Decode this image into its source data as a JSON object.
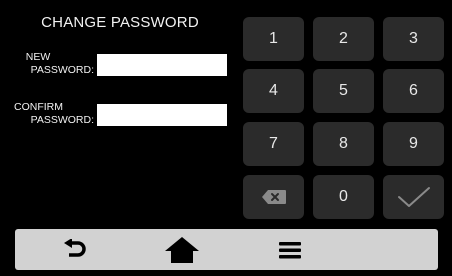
{
  "header": {
    "title": "CHANGE PASSWORD"
  },
  "form": {
    "new_password": {
      "label_line1": "NEW",
      "label_line2": "PASSWORD:",
      "value": ""
    },
    "confirm_password": {
      "label_line1": "CONFIRM",
      "label_line2": "PASSWORD:",
      "value": ""
    }
  },
  "keypad": {
    "keys": [
      "1",
      "2",
      "3",
      "4",
      "5",
      "6",
      "7",
      "8",
      "9",
      "backspace-icon",
      "0",
      "checkmark-icon"
    ],
    "key_color": "#2b2b2b"
  },
  "bottom_bar": {
    "items": [
      "back-arrow-icon",
      "home-icon",
      "menu-icon"
    ],
    "color": "#d2d2d2"
  }
}
